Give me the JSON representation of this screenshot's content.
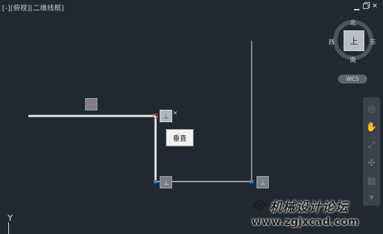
{
  "viewport": {
    "label": "[-][俯视][二维线框]"
  },
  "viewcube": {
    "face": "上",
    "north": "北",
    "south": "南",
    "west": "西",
    "east": "东",
    "wcs_label": "WCS"
  },
  "tooltip": {
    "text": "垂直"
  },
  "grips": {
    "active_close": "×"
  },
  "ucs": {
    "y_label": "Y"
  },
  "watermark": {
    "title": "机械设计论坛",
    "url": "www.zgjxcad.com"
  },
  "colors": {
    "background": "#212830",
    "line": "#c9ced4",
    "selected_line": "#e8ecf0",
    "grip_point": "#2e8ae6"
  }
}
